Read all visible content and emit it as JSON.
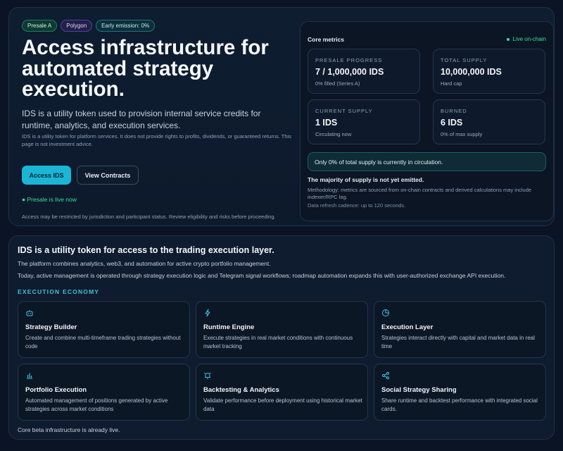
{
  "hero": {
    "badges": [
      "Presale A",
      "Polygon",
      "Early emission: 0%"
    ],
    "title": "Access infrastructure for automated strategy execution.",
    "lead": "IDS is a utility token used to provision internal service credits for runtime, analytics, and execution services.",
    "disclaimer": "IDS is a utility token for platform services. It does not provide rights to profits, dividends, or guaranteed returns. This page is not investment advice.",
    "primary_button": "Access IDS",
    "secondary_button": "View Contracts",
    "presale_status": "Presale is live now",
    "access_note": "Access may be restricted by jurisdiction and participant status. Review eligibility and risks before proceeding."
  },
  "metrics": {
    "title": "Core metrics",
    "live_label": "Live on-chain",
    "cards": [
      {
        "label": "PRESALE PROGRESS",
        "value": "7 / 1,000,000 IDS",
        "sub": "0% filled (Series A)"
      },
      {
        "label": "TOTAL SUPPLY",
        "value": "10,000,000 IDS",
        "sub": "Hard cap"
      },
      {
        "label": "CURRENT SUPPLY",
        "value": "1 IDS",
        "sub": "Circulating now"
      },
      {
        "label": "BURNED",
        "value": "6 IDS",
        "sub": "0% of max supply"
      }
    ],
    "notice": "Only 0% of total supply is currently in circulation.",
    "not_emitted": "The majority of supply is not yet emitted.",
    "methodology": "Methodology: metrics are sourced from on-chain contracts and derived calculations may include indexer/RPC lag.",
    "cadence": "Data refresh cadence: up to 120 seconds."
  },
  "about": {
    "title": "IDS is a utility token for access to the trading execution layer.",
    "p1": "The platform combines analytics, web3, and automation for active crypto portfolio management.",
    "p2": "Today, active management is operated through strategy execution logic and Telegram signal workflows; roadmap automation expands this with user-authorized exchange API execution.",
    "economy_heading": "EXECUTION ECONOMY",
    "features": [
      {
        "icon": "robot-icon",
        "title": "Strategy Builder",
        "desc": "Create and combine multi-timeframe trading strategies without code"
      },
      {
        "icon": "bolt-icon",
        "title": "Runtime Engine",
        "desc": "Execute strategies in real market conditions with continuous market tracking"
      },
      {
        "icon": "pie-chart-icon",
        "title": "Execution Layer",
        "desc": "Strategies interact directly with capital and market data in real time"
      },
      {
        "icon": "bar-chart-icon",
        "title": "Portfolio Execution",
        "desc": "Automated management of positions generated by active strategies across market conditions"
      },
      {
        "icon": "alarm-icon",
        "title": "Backtesting & Analytics",
        "desc": "Validate performance before deployment using historical market data"
      },
      {
        "icon": "share-icon",
        "title": "Social Strategy Sharing",
        "desc": "Share runtime and backtest performance with integrated social cards."
      }
    ],
    "beta_note": "Core beta infrastructure is already live."
  }
}
